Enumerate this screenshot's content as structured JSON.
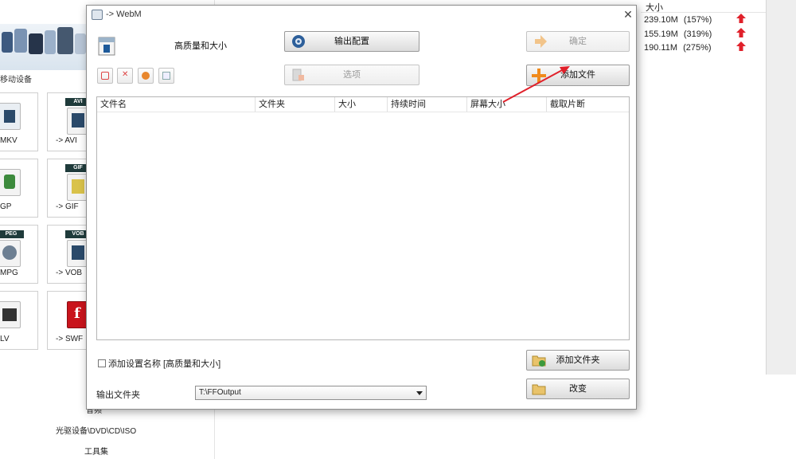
{
  "background_app": {
    "left_panel": {
      "device_category_label": "移动设备",
      "formats": [
        {
          "label": "MKV",
          "tag": ""
        },
        {
          "label": "-> AVI",
          "tag": "AVI"
        },
        {
          "label": "GP",
          "tag": ""
        },
        {
          "label": "-> GIF",
          "tag": "GIF"
        },
        {
          "label": "MPG",
          "tag": "PEG"
        },
        {
          "label": "-> VOB",
          "tag": "VOB"
        },
        {
          "label": "LV",
          "tag": ""
        },
        {
          "label": "-> SWF",
          "tag": "SWF"
        }
      ],
      "bottom_items": [
        "音频",
        "光驱设备\\DVD\\CD\\ISO",
        "工具集"
      ]
    },
    "right_list": {
      "header": "大小",
      "rows": [
        {
          "size": "239.10M",
          "ratio": "(157%)"
        },
        {
          "size": "155.19M",
          "ratio": "(319%)"
        },
        {
          "size": "190.11M",
          "ratio": "(275%)"
        }
      ]
    },
    "colors": {
      "up_arrow": "#e0202a"
    }
  },
  "dialog": {
    "title": "-> WebM",
    "preset_label": "高质量和大小",
    "buttons": {
      "output_config": "输出配置",
      "ok": "确定",
      "options": "选项",
      "add_file": "添加文件",
      "add_folder": "添加文件夹",
      "change": "改变"
    },
    "table_columns": [
      "文件名",
      "文件夹",
      "大小",
      "持续时间",
      "屏幕大小",
      "截取片断"
    ],
    "checkbox_label": "添加设置名称 [高质量和大小]",
    "output_folder_label": "输出文件夹",
    "output_folder_value": "T:\\FFOutput",
    "annotation_color": "#e0202a"
  }
}
